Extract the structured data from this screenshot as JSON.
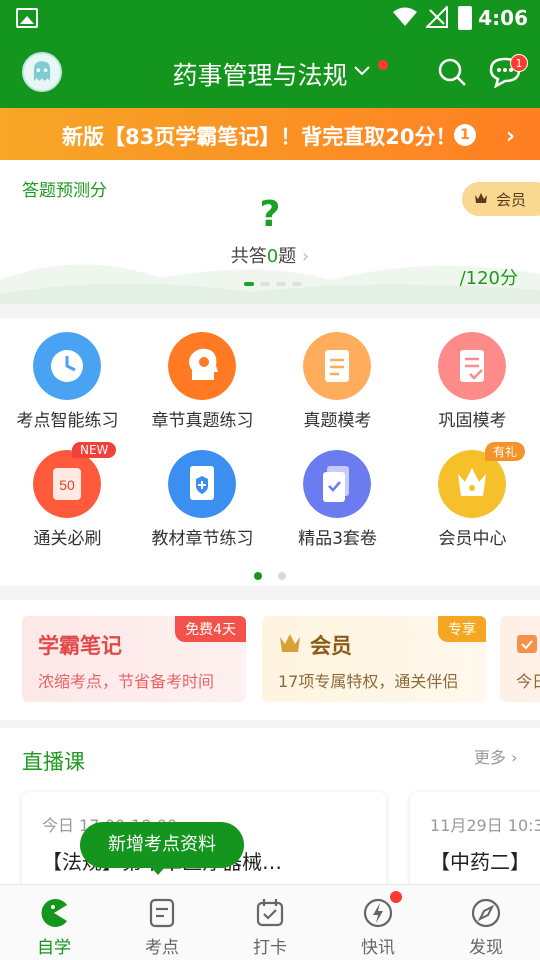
{
  "status_bar": {
    "time": "4:06"
  },
  "header": {
    "title": "药事管理与法规",
    "message_badge": "1"
  },
  "promo": {
    "text": "新版【83页学霸笔记】！背完直取20分！",
    "badge": "1"
  },
  "prediction": {
    "title": "答题预测分",
    "score_value": "?",
    "count_prefix": "共答",
    "count_value": "0",
    "count_suffix": "题",
    "total": "/120分",
    "vip_label": "会员"
  },
  "features": [
    {
      "label": "考点智能练习",
      "icon": "clock-icon",
      "color": "#4aa3f2"
    },
    {
      "label": "章节真题练习",
      "icon": "head-gear-icon",
      "color": "#ff7a22"
    },
    {
      "label": "真题模考",
      "icon": "document-icon",
      "color": "#ffad5c"
    },
    {
      "label": "巩固模考",
      "icon": "checklist-icon",
      "color": "#ff8a8a"
    },
    {
      "label": "通关必刷",
      "icon": "scroll-50-icon",
      "color": "#ff5a3c",
      "tag": "NEW"
    },
    {
      "label": "教材章节练习",
      "icon": "book-plus-icon",
      "color": "#3a8ff0"
    },
    {
      "label": "精品3套卷",
      "icon": "exam-paper-icon",
      "color": "#6b7cf0"
    },
    {
      "label": "会员中心",
      "icon": "crown-icon",
      "color": "#f6c02a",
      "tag": "有礼"
    }
  ],
  "cards": [
    {
      "title": "学霸笔记",
      "subtitle": "浓缩考点，节省备考时间",
      "tag": "免费4天"
    },
    {
      "title": "会员",
      "subtitle": "17项专属特权，通关伴侣",
      "tag": "专享"
    },
    {
      "title": "",
      "subtitle": "今日"
    }
  ],
  "live": {
    "title": "直播课",
    "more": "更多",
    "courses": [
      {
        "time": "今日 17:00-18:00",
        "name": "【法规】第十章医疗器械…"
      },
      {
        "time": "11月29日 10:3",
        "name": "【中药二】"
      }
    ]
  },
  "toast": "新增考点资料",
  "tabs": [
    {
      "label": "自学",
      "icon": "pacman-icon",
      "active": true
    },
    {
      "label": "考点",
      "icon": "note-icon"
    },
    {
      "label": "打卡",
      "icon": "calendar-check-icon"
    },
    {
      "label": "快讯",
      "icon": "lightning-icon",
      "dot": true
    },
    {
      "label": "发现",
      "icon": "compass-icon"
    }
  ],
  "colors": {
    "brand_green": "#14951d",
    "promo_orange": "#ff8a1f",
    "badge_red": "#ff3b30"
  }
}
